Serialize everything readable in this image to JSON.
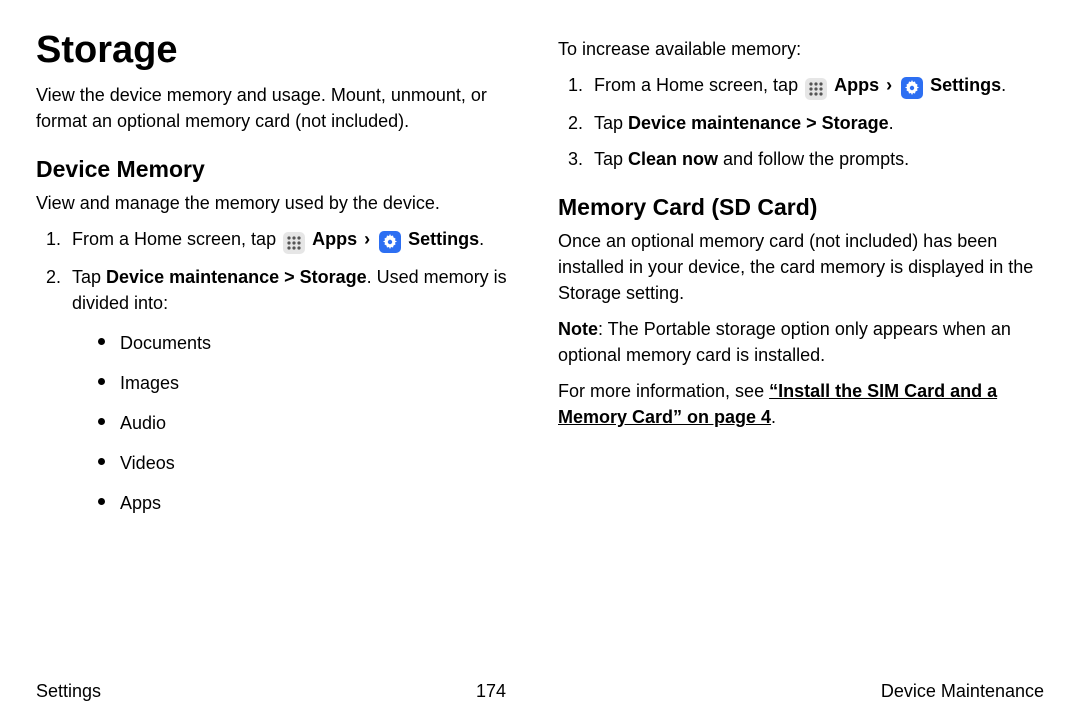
{
  "left": {
    "title": "Storage",
    "intro": "View the device memory and usage. Mount, unmount, or format an optional memory card (not included).",
    "section1_title": "Device Memory",
    "section1_intro": "View and manage the memory used by the device.",
    "step1_pre": "From a Home screen, tap ",
    "apps_label": "Apps",
    "settings_label": "Settings",
    "step2_pre": "Tap ",
    "step2_bold": "Device maintenance > Storage",
    "step2_post": ". Used memory is divided into:",
    "bullets": {
      "b1": "Documents",
      "b2": "Images",
      "b3": "Audio",
      "b4": "Videos",
      "b5": "Apps"
    }
  },
  "right": {
    "top_line": "To increase available memory:",
    "r_step1_pre": "From a Home screen, tap ",
    "r_apps_label": "Apps",
    "r_settings_label": "Settings",
    "r_step2_pre": "Tap ",
    "r_step2_bold": "Device maintenance > Storage",
    "r_step3_pre": "Tap ",
    "r_step3_bold": "Clean now",
    "r_step3_post": " and follow the prompts.",
    "section2_title": "Memory Card (SD Card)",
    "section2_intro": "Once an optional memory card (not included) has been installed in your device, the card memory is displayed in the Storage setting.",
    "note_label": "Note",
    "note_body": ": The Portable storage option only appears when an optional memory card is installed.",
    "moreinfo_pre": "For more information, see ",
    "moreinfo_link": "“Install the SIM Card and a Memory Card” on page 4"
  },
  "footer": {
    "left": "Settings",
    "center": "174",
    "right": "Device Maintenance"
  }
}
